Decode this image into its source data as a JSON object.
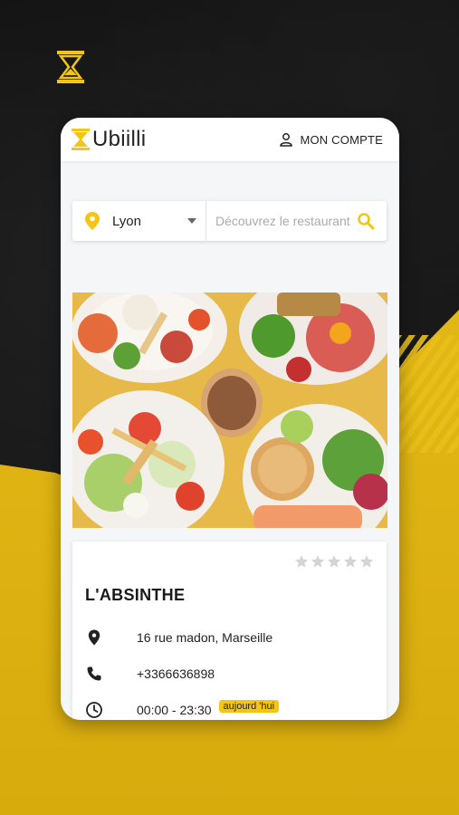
{
  "brand": {
    "name": "Ubiilli",
    "accent": "#f4c514"
  },
  "header": {
    "account_label": "MON COMPTE",
    "account_icon": "user-icon"
  },
  "search": {
    "city": "Lyon",
    "placeholder": "Découvrez le restaurant",
    "value": ""
  },
  "restaurant": {
    "name": "L'ABSINTHE",
    "rating_stars": 0,
    "rating_max": 5,
    "address": "16 rue madon, Marseille",
    "phone": "+3366636898",
    "hours": "00:00 - 23:30",
    "today_badge": "aujourd 'hui"
  }
}
